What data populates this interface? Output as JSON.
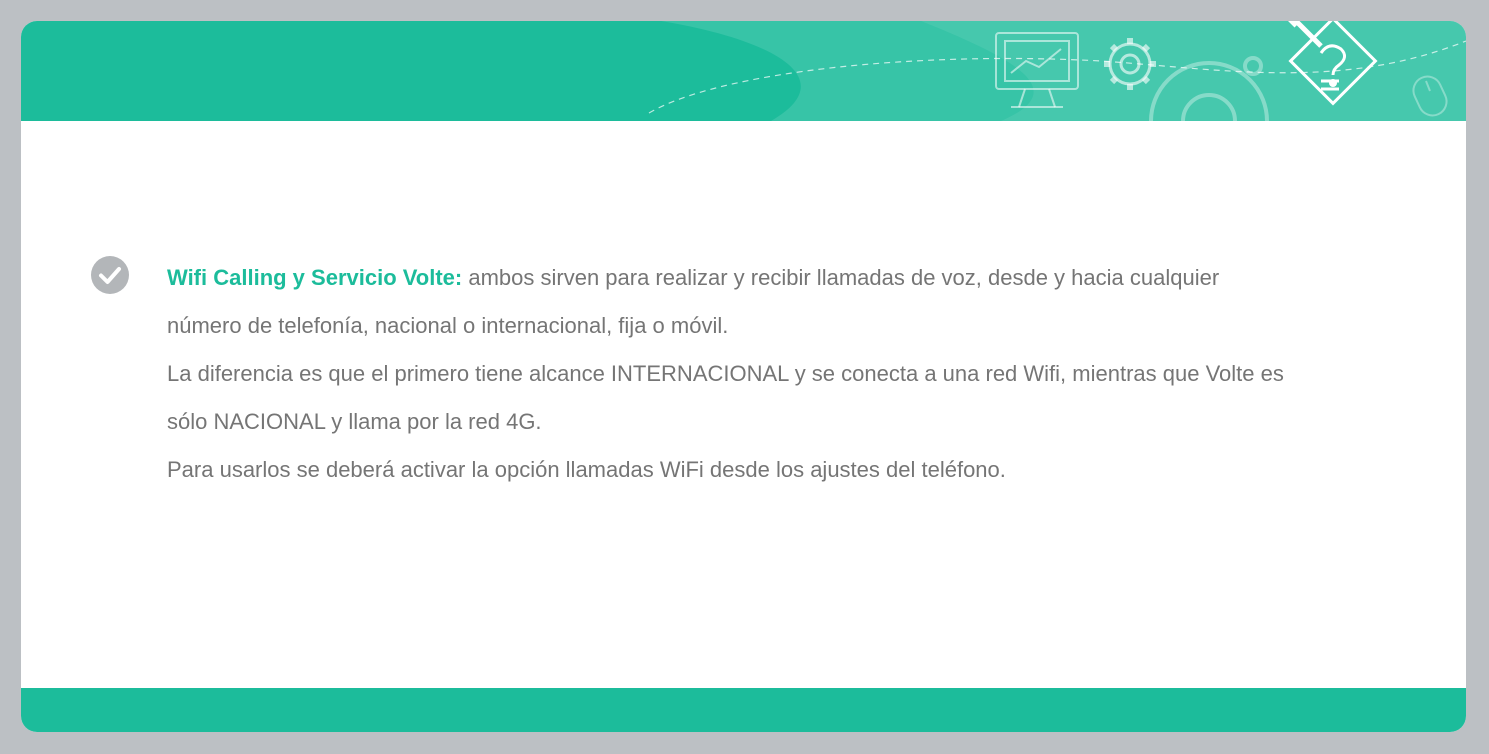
{
  "colors": {
    "accent": "#1cbc9b",
    "background": "#bcc0c4",
    "text": "#757575",
    "icon_gray": "#b3b6b9"
  },
  "header": {
    "icons": [
      "monitor-chart-icon",
      "gear-icon",
      "large-gear-icon",
      "pencil-question-icon",
      "mouse-icon"
    ]
  },
  "bullet": {
    "icon": "check-circle-icon",
    "title": "Wifi Calling y Servicio Volte:",
    "paragraph1": " ambos sirven para realizar y recibir llamadas de voz, desde y hacia cualquier número de telefonía, nacional o internacional, fija o móvil.",
    "paragraph2": "La diferencia es que el primero tiene alcance INTERNACIONAL y se conecta a una red Wifi, mientras que Volte es sólo NACIONAL y llama por la red 4G.",
    "paragraph3": "Para usarlos se deberá activar la opción llamadas WiFi desde los ajustes del teléfono."
  }
}
